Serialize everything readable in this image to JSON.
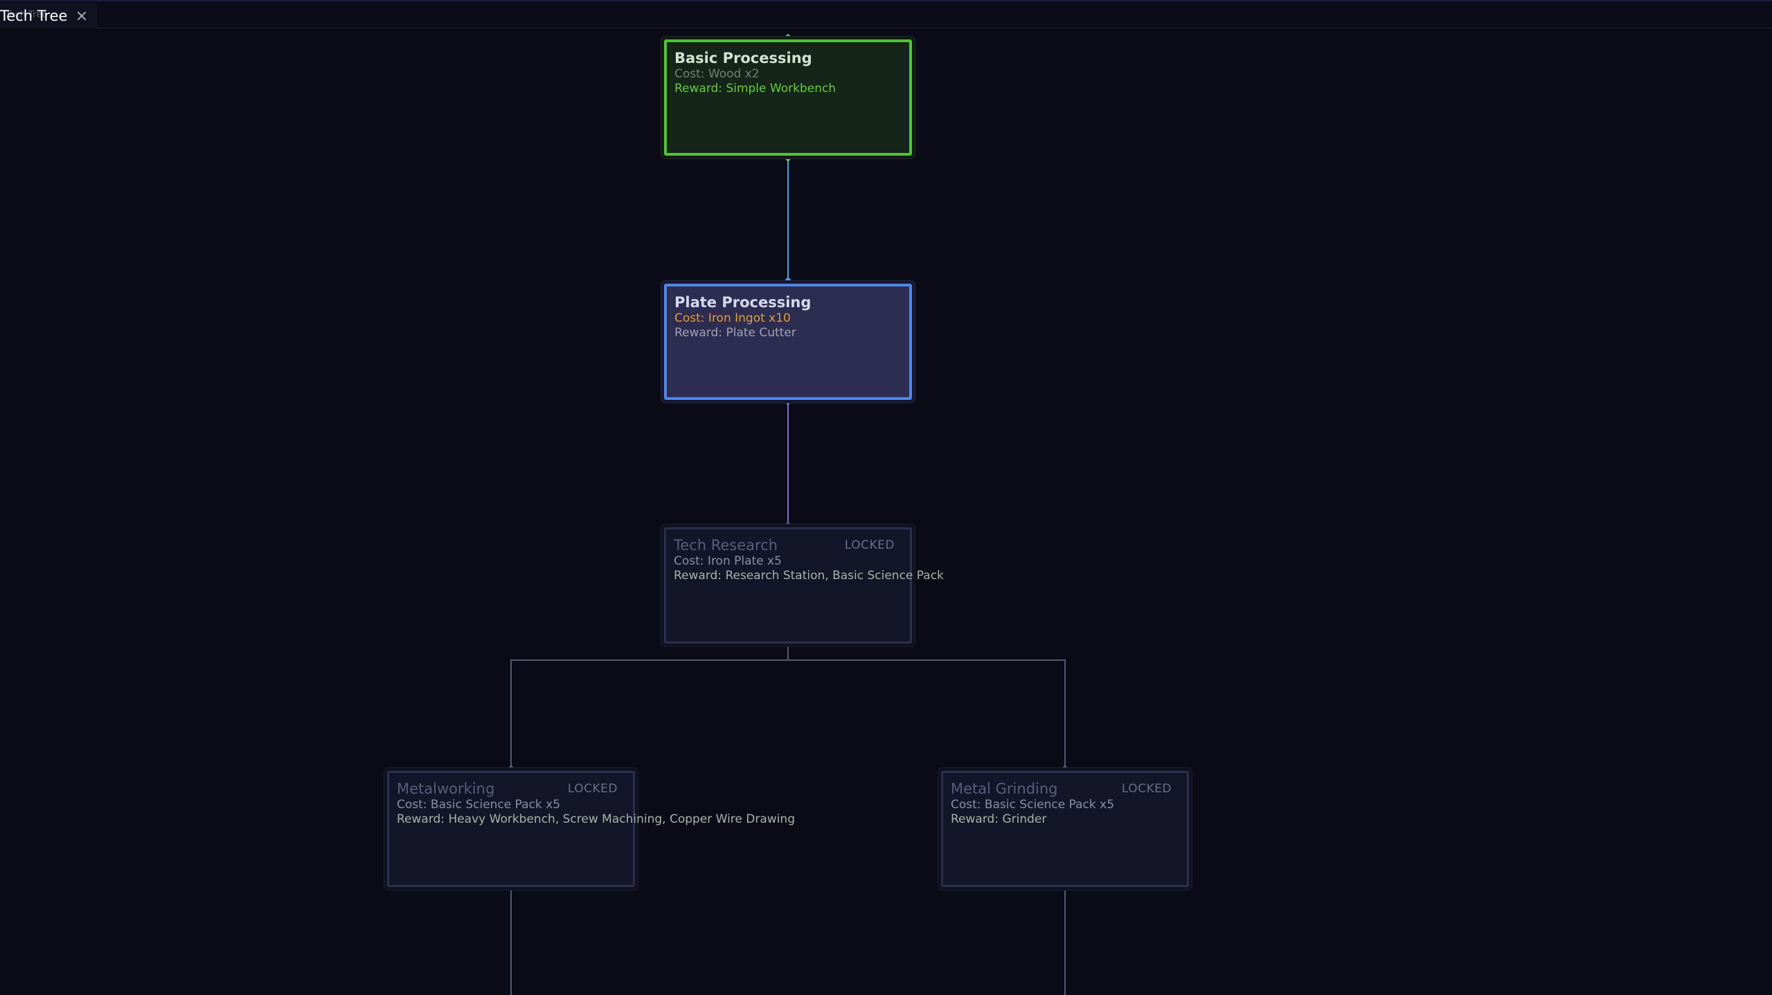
{
  "window": {
    "tab_title": "Tech Tree",
    "tab_title_ghost": "Tech Tree"
  },
  "colors": {
    "completed_accent": "#52c33a",
    "available_accent": "#4e86e8",
    "cost_highlight": "#e59a3f",
    "edge_completed": "#4aa6d8",
    "edge_available": "#8a6cd4",
    "edge_locked": "#55586c",
    "background": "#0b0b17"
  },
  "nodes": [
    {
      "id": "basic-processing",
      "title": "Basic Processing",
      "status": "",
      "state": "completed",
      "cost": "Cost: Wood x2",
      "reward": "Reward: Simple Workbench"
    },
    {
      "id": "plate-processing",
      "title": "Plate Processing",
      "status": "",
      "state": "available",
      "cost": "Cost: Iron Ingot x10",
      "reward": "Reward: Plate Cutter"
    },
    {
      "id": "tech-research",
      "title": "Tech Research",
      "status": "LOCKED",
      "state": "locked",
      "cost": "Cost: Iron Plate x5",
      "reward": "Reward: Research Station, Basic Science Pack"
    },
    {
      "id": "metalworking",
      "title": "Metalworking",
      "status": "LOCKED",
      "state": "locked",
      "cost": "Cost: Basic Science Pack x5",
      "reward": "Reward: Heavy Workbench, Screw Machining, Copper Wire Drawing"
    },
    {
      "id": "metal-grinding",
      "title": "Metal Grinding",
      "status": "LOCKED",
      "state": "locked",
      "cost": "Cost: Basic Science Pack x5",
      "reward": "Reward: Grinder"
    }
  ]
}
